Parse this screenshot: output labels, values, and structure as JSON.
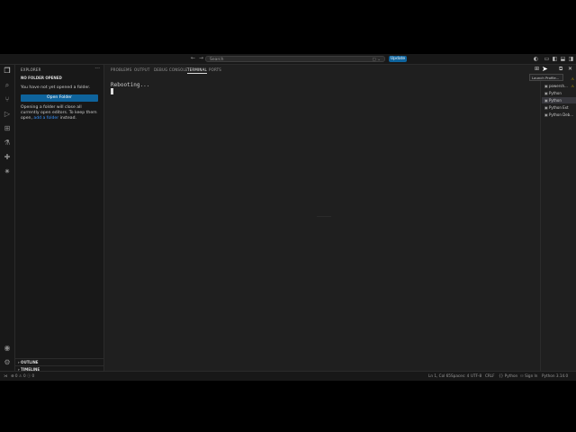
{
  "titlebar": {
    "search_placeholder": "Search",
    "update_label": "Update"
  },
  "activity_bar": {
    "icons": [
      "files-icon",
      "search-icon",
      "source-control-icon",
      "run-debug-icon",
      "extensions-icon",
      "testing-icon",
      "python-icon",
      "remote-explorer-icon",
      "account-icon",
      "settings-gear-icon"
    ]
  },
  "sidebar": {
    "title": "EXPLORER",
    "more": "···",
    "section": "NO FOLDER OPENED",
    "message": "You have not yet opened a folder.",
    "open_folder_label": "Open Folder",
    "message2_pre": "Opening a folder will close all currently open editors. To keep them open,",
    "message2_link": "add a folder",
    "message2_post": "instead.",
    "outline_label": "OUTLINE",
    "timeline_label": "TIMELINE"
  },
  "panel": {
    "tabs": [
      {
        "label": "PROBLEMS"
      },
      {
        "label": "OUTPUT"
      },
      {
        "label": "DEBUG CONSOLE"
      },
      {
        "label": "TERMINAL",
        "active": true
      },
      {
        "label": "PORTS"
      }
    ],
    "terminal_text": "Rebooting..."
  },
  "terminal_list": {
    "items": [
      {
        "label": "powersh...",
        "warn": "⚠"
      },
      {
        "label": "Python",
        "warn": ""
      },
      {
        "label": "Python",
        "warn": "",
        "active": true
      },
      {
        "label": "Python Ext",
        "warn": ""
      },
      {
        "label": "Python Deb...",
        "warn": ""
      }
    ],
    "first_label": "zsh",
    "tooltip": "Launch Profile..."
  },
  "statusbar": {
    "left_errors": "0",
    "left_warnings": "0",
    "left_info": "0",
    "position": "Ln 1, Col 65",
    "spaces": "Spaces: 4",
    "encoding": "UTF-8",
    "eol": "CRLF",
    "language": "Python",
    "signin": "Sign In",
    "interpreter": "Python 3.14.0"
  },
  "colors": {
    "accent": "#0e639c",
    "link": "#3794ff",
    "warning": "#cca700"
  }
}
